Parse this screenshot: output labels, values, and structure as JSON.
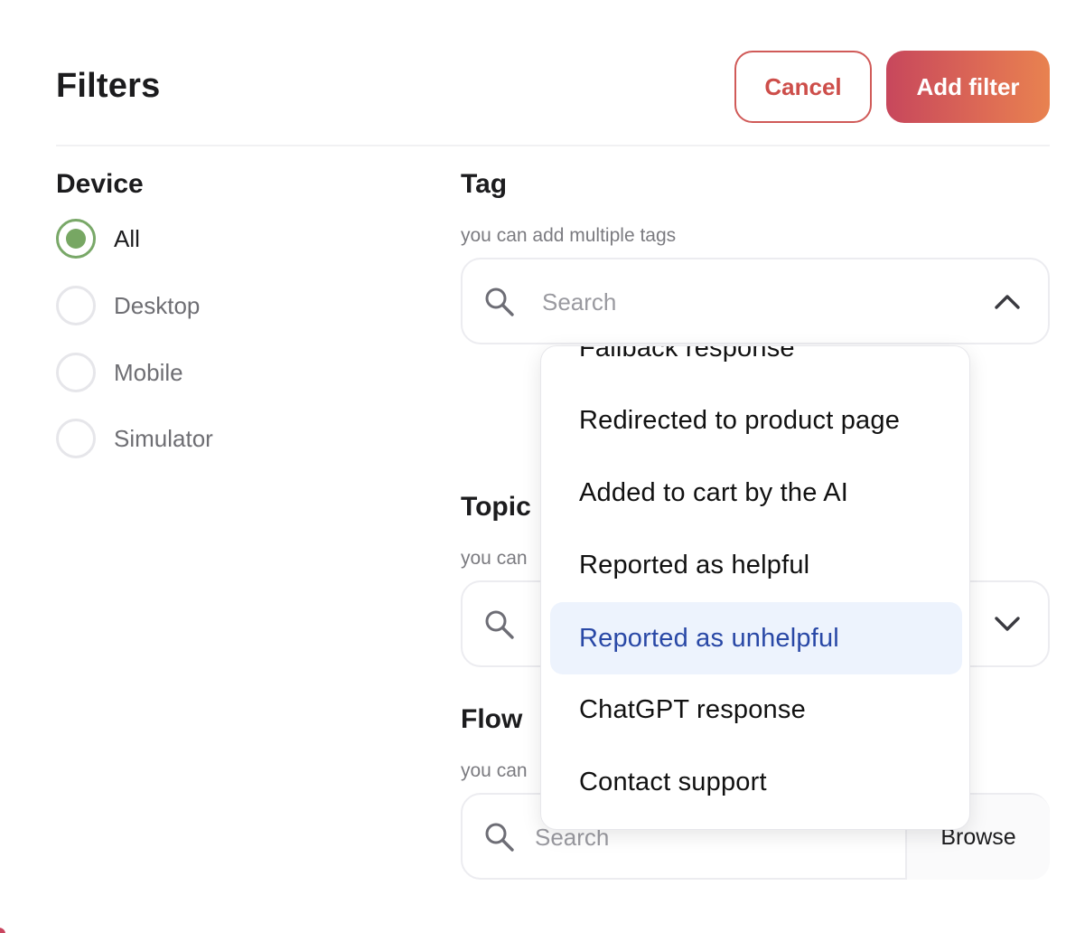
{
  "header": {
    "title": "Filters",
    "cancel_label": "Cancel",
    "add_label": "Add filter"
  },
  "device": {
    "title": "Device",
    "options": [
      {
        "label": "All",
        "selected": true
      },
      {
        "label": "Desktop",
        "selected": false
      },
      {
        "label": "Mobile",
        "selected": false
      },
      {
        "label": "Simulator",
        "selected": false
      }
    ]
  },
  "tag": {
    "title": "Tag",
    "hint": "you can add multiple tags",
    "placeholder": "Search",
    "expanded": true
  },
  "topic": {
    "title": "Topic",
    "hint": "you can"
  },
  "flow": {
    "title": "Flow",
    "hint": "you can",
    "placeholder": "Search",
    "browse_label": "Browse"
  },
  "dropdown": {
    "items": [
      {
        "label": "Fallback response",
        "highlighted": false
      },
      {
        "label": "Redirected to product page",
        "highlighted": false
      },
      {
        "label": "Added to cart by the AI",
        "highlighted": false
      },
      {
        "label": "Reported as helpful",
        "highlighted": false
      },
      {
        "label": "Reported as unhelpful",
        "highlighted": true
      },
      {
        "label": "ChatGPT response",
        "highlighted": false
      },
      {
        "label": "Contact support",
        "highlighted": false
      }
    ]
  },
  "colors": {
    "accent_start": "#c7475c",
    "accent_end": "#e88250",
    "radio_selected": "#77a763",
    "highlight_bg": "#edf3fd",
    "highlight_text": "#2948a6"
  },
  "icons": [
    "search-icon",
    "chevron-up-icon",
    "chevron-down-icon"
  ]
}
